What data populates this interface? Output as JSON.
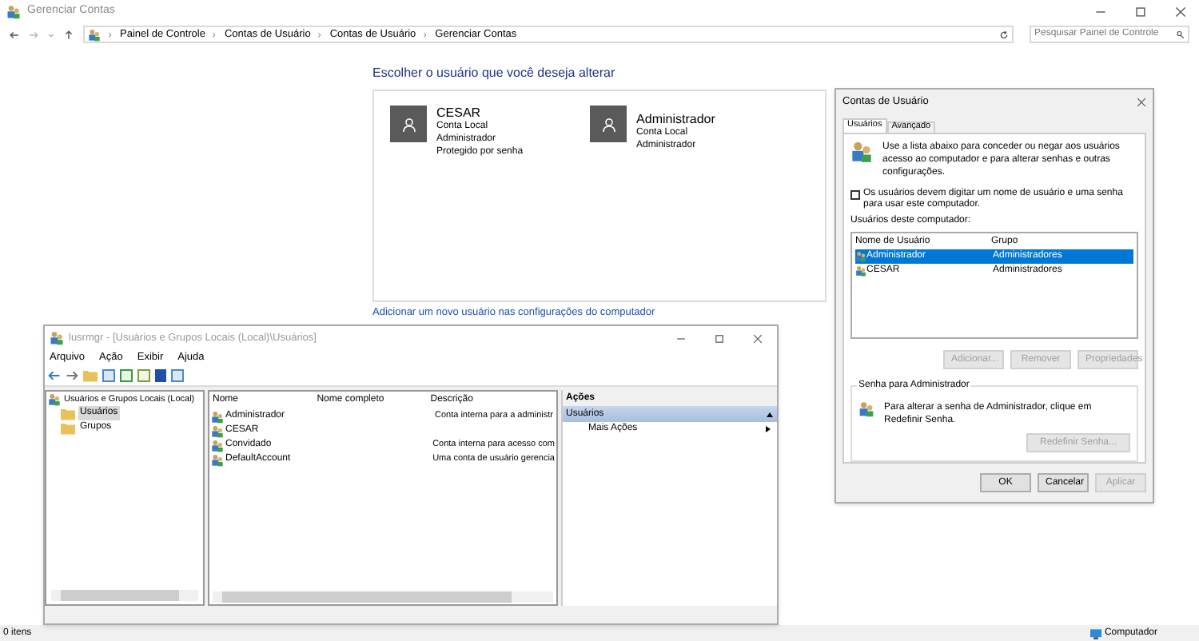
{
  "window": {
    "title": "Gerenciar Contas"
  },
  "address": {
    "breadcrumbs": [
      "Painel de Controle",
      "Contas de Usuário",
      "Contas de Usuário",
      "Gerenciar Contas"
    ]
  },
  "search": {
    "placeholder": "Pesquisar Painel de Controle"
  },
  "heading": "Escolher o usuário que você deseja alterar",
  "users": [
    {
      "name": "CESAR",
      "lines": [
        "Conta Local",
        "Administrador",
        "Protegido por senha"
      ]
    },
    {
      "name": "Administrador",
      "lines": [
        "Conta Local",
        "Administrador"
      ]
    }
  ],
  "add_link": "Adicionar um novo usuário nas configurações do computador",
  "lusrmgr": {
    "title": "lusrmgr - [Usuários e Grupos Locais (Local)\\Usuários]",
    "menu": [
      "Arquivo",
      "Ação",
      "Exibir",
      "Ajuda"
    ],
    "tree": {
      "label": "Usuários e Grupos Locais (Local)",
      "children": [
        {
          "label": "Usuários",
          "selected": true
        },
        {
          "label": "Grupos",
          "selected": false
        }
      ]
    },
    "columns": [
      "Nome",
      "Nome completo",
      "Descrição"
    ],
    "rows": [
      {
        "name": "Administrador",
        "description": "Conta interna para a administr"
      },
      {
        "name": "CESAR",
        "description": ""
      },
      {
        "name": "Convidado",
        "description": "Conta interna para acesso com"
      },
      {
        "name": "DefaultAccount",
        "description": "Uma conta de usuário gerencia"
      }
    ],
    "actions": {
      "header": "Ações",
      "section": "Usuários",
      "items": [
        "Mais Ações"
      ]
    }
  },
  "dialog": {
    "title": "Contas de Usuário",
    "tabs": [
      {
        "label": "Usuários",
        "selected": true
      },
      {
        "label": "Avançado",
        "selected": false
      }
    ],
    "intro": "Use a lista abaixo para conceder ou negar aos usuários acesso ao computador e para alterar senhas e outras configurações.",
    "checkbox": {
      "label": "Os usuários devem digitar um nome de usuário e uma senha para usar este computador.",
      "checked": false
    },
    "list_label": "Usuários deste computador:",
    "columns": [
      "Nome de Usuário",
      "Grupo"
    ],
    "rows": [
      {
        "user": "Administrador",
        "group": "Administradores",
        "selected": true
      },
      {
        "user": "CESAR",
        "group": "Administradores",
        "selected": false
      }
    ],
    "list_buttons": [
      {
        "label": "Adicionar...",
        "disabled": true
      },
      {
        "label": "Remover",
        "disabled": true
      },
      {
        "label": "Propriedades",
        "disabled": true
      }
    ],
    "password": {
      "title": "Senha para Administrador",
      "text": "Para alterar a senha de Administrador, clique em Redefinir Senha.",
      "button": {
        "label": "Redefinir Senha...",
        "disabled": true
      }
    },
    "footer_buttons": [
      {
        "label": "OK",
        "disabled": false
      },
      {
        "label": "Cancelar",
        "disabled": false
      },
      {
        "label": "Aplicar",
        "disabled": true
      }
    ]
  },
  "status_bar": {
    "count": "0 itens",
    "location": "Computador"
  }
}
